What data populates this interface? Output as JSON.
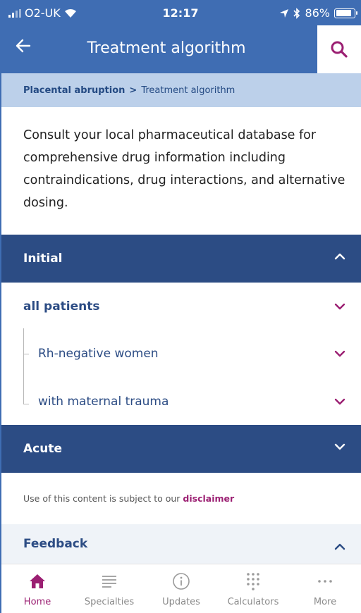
{
  "status_bar": {
    "carrier": "O2-UK",
    "time": "12:17",
    "battery": "86%"
  },
  "header": {
    "title": "Treatment algorithm",
    "back_icon": "arrow-left-icon",
    "search_icon": "search-icon"
  },
  "breadcrumb": {
    "parent": "Placental abruption",
    "separator": ">",
    "current": "Treatment algorithm"
  },
  "intro": "Consult your local pharmaceutical database for comprehensive drug information including contraindications, drug interactions, and alternative dosing.",
  "sections": {
    "initial": {
      "label": "Initial",
      "rows": {
        "all_patients": "all patients",
        "rh_negative": "Rh-negative women",
        "maternal_trauma": "with maternal trauma"
      }
    },
    "acute": {
      "label": "Acute"
    }
  },
  "disclaimer": {
    "text": "Use of this content is subject to our ",
    "link": "disclaimer"
  },
  "feedback": {
    "label": "Feedback"
  },
  "tabs": {
    "home": "Home",
    "specialties": "Specialties",
    "updates": "Updates",
    "calculators": "Calculators",
    "more": "More"
  },
  "colors": {
    "header_blue": "#3f6db3",
    "section_navy": "#2c4c84",
    "accent_magenta": "#9b1f72",
    "breadcrumb_bg": "#bcd0ea"
  }
}
